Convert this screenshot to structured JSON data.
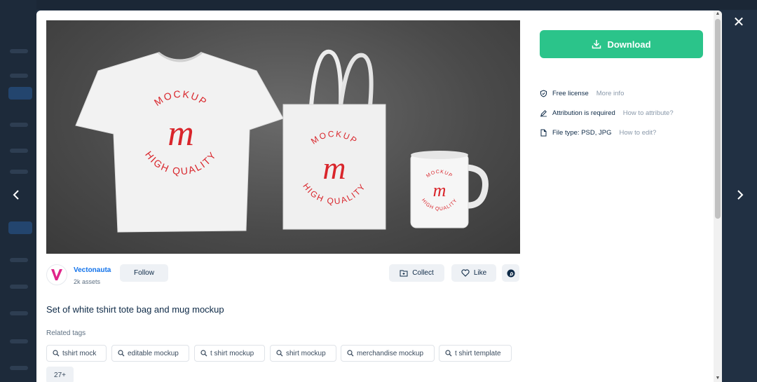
{
  "modal": {
    "close_icon": "close-icon",
    "prev_icon": "chevron-left-icon",
    "next_icon": "chevron-right-icon"
  },
  "preview": {
    "badge_top": "MOCKUP",
    "badge_bottom": "HIGH QUALITY",
    "badge_letter": "m",
    "badge_color": "#d9252b"
  },
  "author": {
    "name": "Vectonauta",
    "assets": "2k assets",
    "follow_label": "Follow",
    "avatar_color": "#e0248a"
  },
  "actions": {
    "collect_label": "Collect",
    "like_label": "Like",
    "pinterest_icon": "pinterest-icon"
  },
  "asset": {
    "title": "Set of white tshirt tote bag and mug mockup",
    "related_tags_label": "Related tags",
    "tags": [
      "tshirt mock",
      "editable mockup",
      "t shirt mockup",
      "shirt mockup",
      "merchandise mockup",
      "t shirt template"
    ],
    "more_tags": "27+"
  },
  "sidebar": {
    "download_label": "Download",
    "download_color": "#2bc48a",
    "license": {
      "text": "Free license",
      "link": "More info"
    },
    "attribution": {
      "text": "Attribution is required",
      "link": "How to attribute?"
    },
    "filetype": {
      "label": "File type:",
      "value": "PSD, JPG",
      "link": "How to edit?"
    }
  }
}
